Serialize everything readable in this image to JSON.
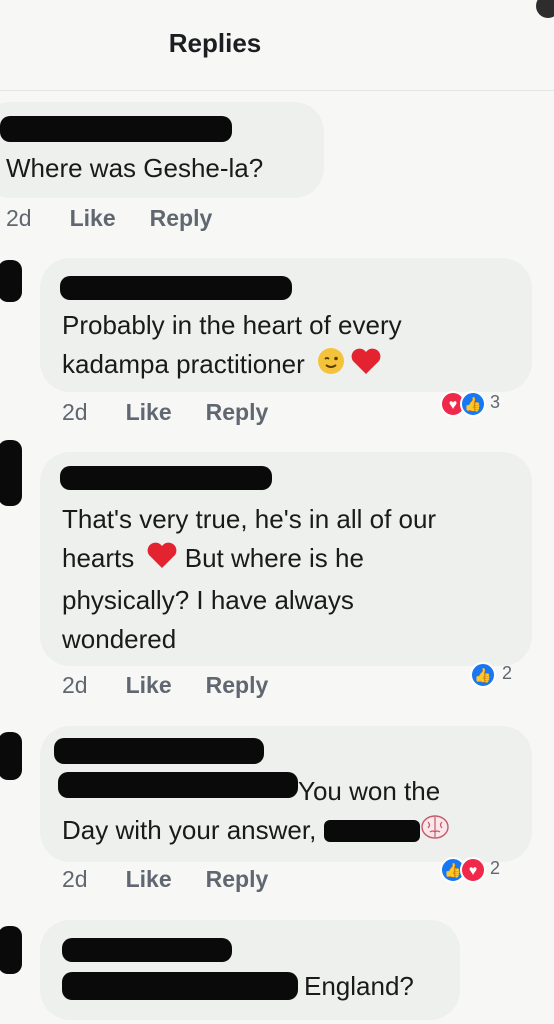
{
  "header": {
    "title": "Replies"
  },
  "comments": [
    {
      "text": "Where was Geshe-la?",
      "time": "2d",
      "like": "Like",
      "reply": "Reply"
    },
    {
      "text_lines": [
        "Probably in the heart of every",
        "kadampa practitioner"
      ],
      "emoji_icons": [
        "wink-emoji-icon",
        "red-heart-icon"
      ],
      "time": "2d",
      "like": "Like",
      "reply": "Reply",
      "reactions": [
        "love",
        "like"
      ],
      "reaction_count": "3"
    },
    {
      "text_lines": [
        "That's very true, he's in all of our",
        "hearts",
        "But where is he",
        "physically? I have always",
        "wondered"
      ],
      "emoji_icons": [
        "red-heart-icon"
      ],
      "time": "2d",
      "like": "Like",
      "reply": "Reply",
      "reactions": [
        "like"
      ],
      "reaction_count": "2"
    },
    {
      "text_lines": [
        "You won the",
        "Day with your answer,"
      ],
      "emoji_icons": [
        "brain-emoji-icon"
      ],
      "time": "2d",
      "like": "Like",
      "reply": "Reply",
      "reactions": [
        "like",
        "love"
      ],
      "reaction_count": "2"
    },
    {
      "text_lines": [
        "England?"
      ]
    }
  ],
  "colors": {
    "accent_like": "#1877f2",
    "accent_love": "#f0284a",
    "bubble": "#eef0ee",
    "meta": "#606770"
  }
}
